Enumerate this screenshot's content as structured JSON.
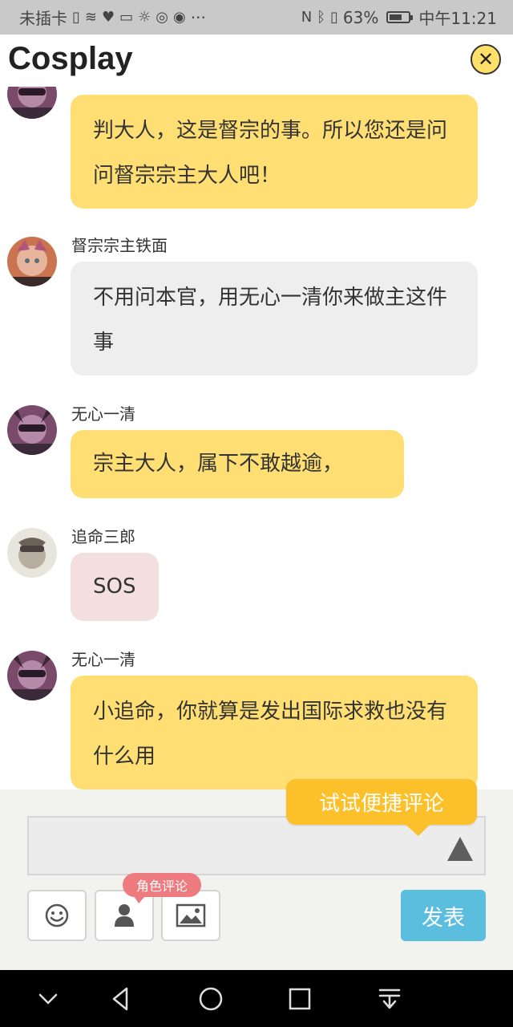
{
  "status_bar": {
    "carrier": "未插卡",
    "dots": "···",
    "battery_percent": "63%",
    "time": "中午11:21"
  },
  "header": {
    "title": "Cosplay",
    "close_symbol": "✕"
  },
  "messages": [
    {
      "sender": "",
      "text": "判大人，这是督宗的事。所以您还是问问督宗宗主大人吧！",
      "bubble_color": "#ffdf73",
      "avatar": "wuxin-yiqing"
    },
    {
      "sender": "督宗宗主铁面",
      "text": "不用问本官，用无心一清你来做主这件事",
      "bubble_color": "#eeeeee",
      "avatar": "tiemian"
    },
    {
      "sender": "无心一清",
      "text": "宗主大人，属下不敢越逾，",
      "bubble_color": "#ffdf73",
      "avatar": "wuxin-yiqing"
    },
    {
      "sender": "追命三郎",
      "text": "SOS",
      "bubble_color": "#f3dfe0",
      "avatar": "zhuiming-sanlang"
    },
    {
      "sender": "无心一清",
      "text": "小追命，你就算是发出国际求救也没有什么用",
      "bubble_color": "#ffdf73",
      "avatar": "wuxin-yiqing"
    }
  ],
  "composer": {
    "tip": "试试便捷评论",
    "role_tag": "角色评论",
    "send_label": "发表",
    "input_value": "",
    "tools": [
      "emoji-icon",
      "person-icon",
      "image-icon"
    ]
  },
  "colors": {
    "accent_yellow": "#ffdf73",
    "tip_orange": "#fcc02a",
    "send_blue": "#5bbedf",
    "role_pink": "#ee7b7f"
  }
}
